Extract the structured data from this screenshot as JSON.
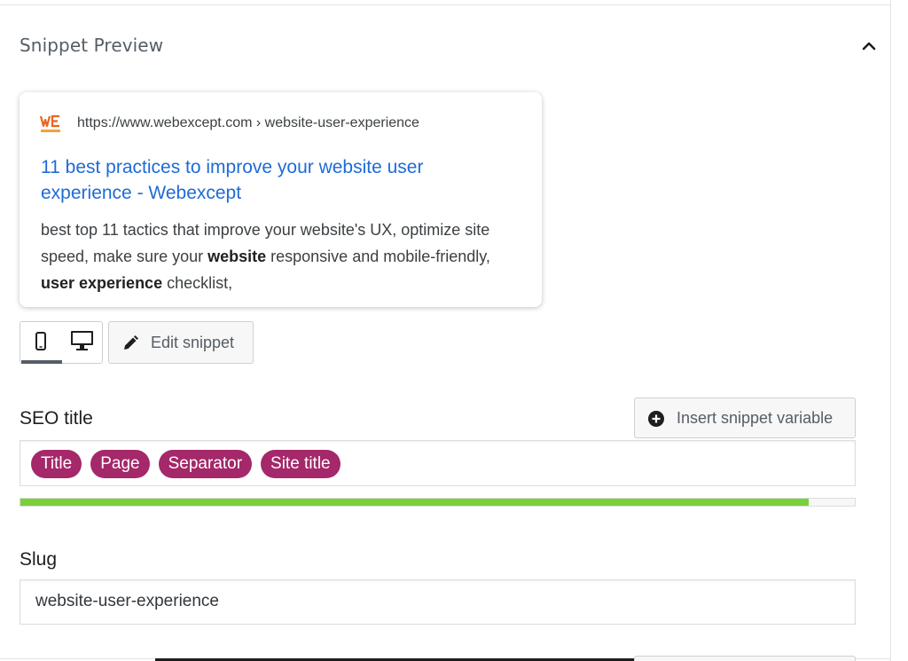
{
  "panel": {
    "title": "Snippet Preview"
  },
  "snippet": {
    "url": "https://www.webexcept.com › website-user-experience",
    "title": "11 best practices to improve your website user experience - Webexcept",
    "description": {
      "p1": "best top 11 tactics that improve your website's UX, optimize site speed, make sure your ",
      "b1": "website",
      "p2": " responsive and mobile-friendly, ",
      "b2": "user experience",
      "p3": " checklist,"
    },
    "favicon_colors": {
      "primary": "#e8651f",
      "secondary": "#f3a13b"
    }
  },
  "view": {
    "active": "mobile"
  },
  "edit_snippet_label": "Edit snippet",
  "seo": {
    "label": "SEO title",
    "insert_variable_label": "Insert snippet variable",
    "pills": [
      "Title",
      "Page",
      "Separator",
      "Site title"
    ],
    "progress_fraction": 0.945,
    "pill_color": "#a4286a",
    "progress_color": "#7ad03a"
  },
  "slug": {
    "label": "Slug",
    "value": "website-user-experience"
  }
}
